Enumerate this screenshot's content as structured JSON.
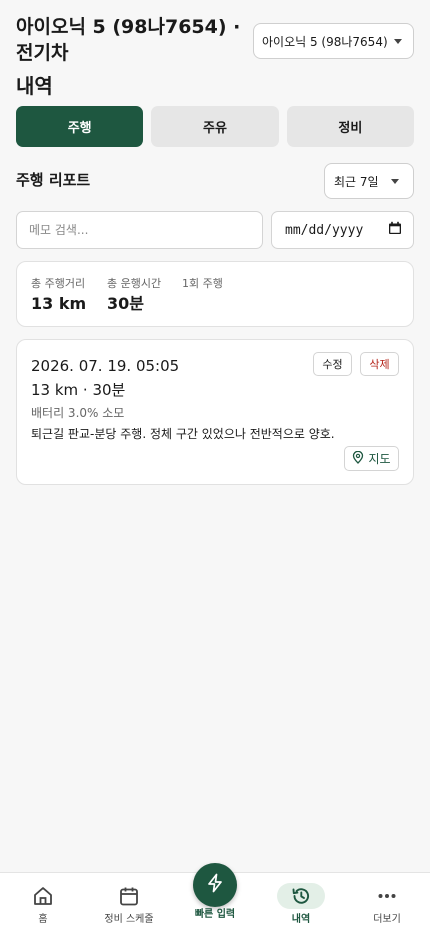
{
  "header": {
    "vehicle_title": "아이오닉 5 (98나7654) · 전기차",
    "vehicle_select": "아이오닉 5 (98나7654)",
    "page_title": "내역"
  },
  "tabs": [
    {
      "label": "주행",
      "active": true
    },
    {
      "label": "주유",
      "active": false
    },
    {
      "label": "정비",
      "active": false
    }
  ],
  "report": {
    "title": "주행 리포트",
    "period": "최근 7일"
  },
  "filters": {
    "memo_placeholder": "메모 검색...",
    "date_placeholder": "mm/dd/yyyy"
  },
  "summary": {
    "total_distance_label": "총 주행거리",
    "total_distance_value": "13 km",
    "total_time_label": "총 운행시간",
    "total_time_value": "30분",
    "per_trip_label": "1회 주행"
  },
  "trips": [
    {
      "datetime": "2026. 07. 19. 05:05",
      "distance_time": "13 km · 30분",
      "battery": "배터리 3.0% 소모",
      "memo": "퇴근길 판교-분당 주행. 정체 구간 있었으나 전반적으로 양호.",
      "edit_label": "수정",
      "delete_label": "삭제",
      "map_label": "지도"
    }
  ],
  "bottom_nav": {
    "home": "홈",
    "schedule": "정비 스케줄",
    "quick": "빠른 입력",
    "history": "내역",
    "more": "더보기"
  },
  "colors": {
    "primary": "#1e5740",
    "danger": "#b42318",
    "background": "#f7f7f7"
  },
  "icons": [
    "home-icon",
    "calendar-icon",
    "lightning-icon",
    "history-icon",
    "more-icon",
    "map-pin-icon",
    "calendar-picker-icon"
  ]
}
